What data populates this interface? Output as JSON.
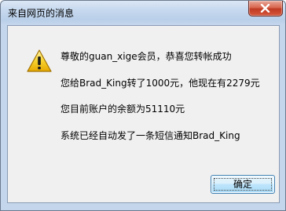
{
  "window": {
    "title": "来自网页的消息",
    "close_icon": "close-icon"
  },
  "dialog": {
    "icon": "warning-icon",
    "lines": [
      "尊敬的guan_xige会员，恭喜您转帐成功",
      "您给Brad_King转了1000元，他现在有2279元",
      "您目前账户的余额为51110元",
      "系统已经自动发了一条短信通知Brad_King"
    ],
    "ok_label": "确定"
  },
  "colors": {
    "close_button": "#c9472f",
    "ok_button_border": "#3c7fb1",
    "warning_fill": "#f2c200"
  }
}
